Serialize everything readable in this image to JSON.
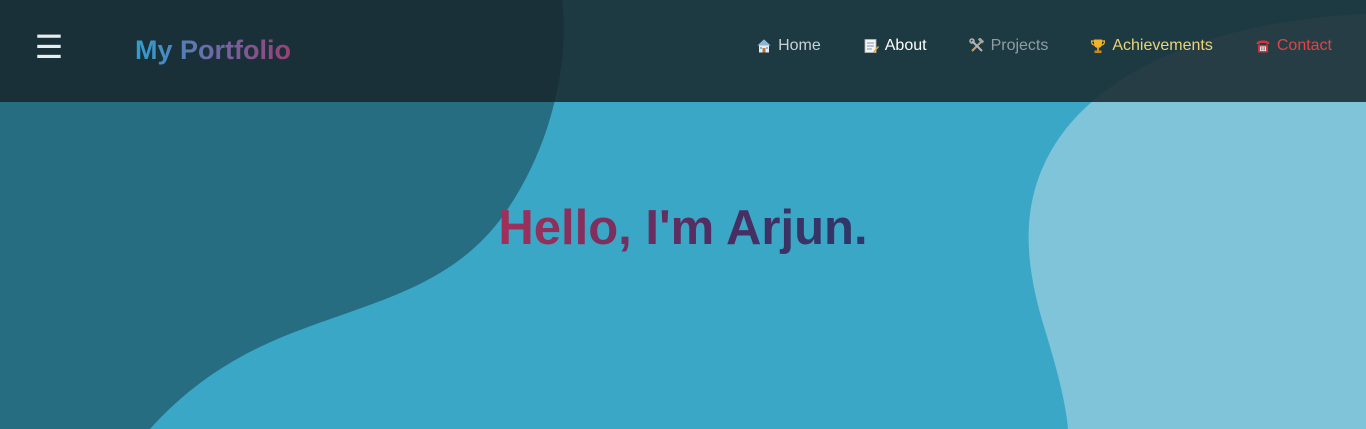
{
  "colors": {
    "background": "#3ba7c6",
    "dark_blob": "#266d82",
    "light_blob": "#80c4da",
    "navbar": "#1d2a31",
    "contact": "#e24446",
    "achievements": "#e9d47a"
  },
  "header": {
    "menu_icon": "hamburger-icon",
    "menu_glyph": "☰",
    "brand": "My Portfolio"
  },
  "nav": {
    "items": [
      {
        "label": "Home",
        "icon": "house-icon"
      },
      {
        "label": "About",
        "icon": "memo-icon"
      },
      {
        "label": "Projects",
        "icon": "hammer-wrench-icon"
      },
      {
        "label": "Achievements",
        "icon": "trophy-icon"
      },
      {
        "label": "Contact",
        "icon": "telephone-icon"
      }
    ]
  },
  "hero": {
    "title": "Hello, I'm Arjun."
  }
}
